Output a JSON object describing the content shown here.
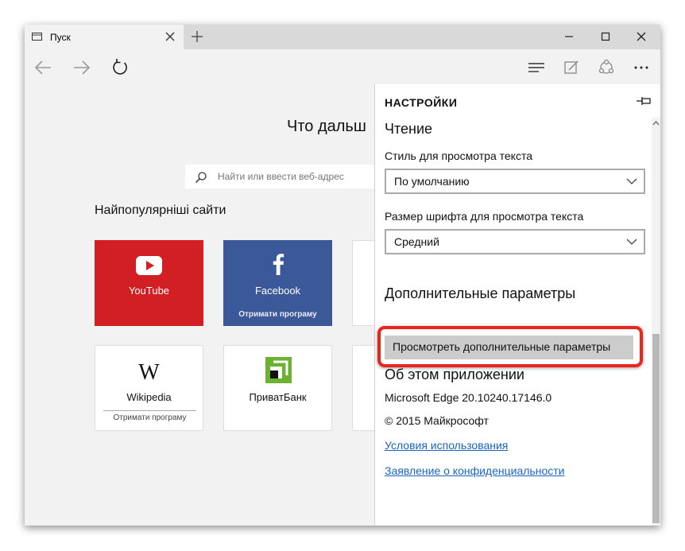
{
  "window": {
    "tab_title": "Пуск"
  },
  "start_page": {
    "heading": "Что дальш",
    "search_placeholder": "Найти или ввести веб-адрес",
    "top_sites_title": "Найпопулярніші сайти",
    "tiles": [
      {
        "label": "YouTube",
        "sub": ""
      },
      {
        "label": "Facebook",
        "sub": "Отримати програму"
      },
      {
        "label": "Wikipedia",
        "sub": "Отримати програму"
      },
      {
        "label": "ПриватБанк",
        "sub": ""
      }
    ],
    "wikipedia_logo_text": "W"
  },
  "settings": {
    "title": "НАСТРОЙКИ",
    "reading_heading": "Чтение",
    "reading_style_label": "Стиль для просмотра текста",
    "reading_style_value": "По умолчанию",
    "font_size_label": "Размер шрифта для просмотра текста",
    "font_size_value": "Средний",
    "advanced_heading": "Дополнительные параметры",
    "advanced_button": "Просмотреть дополнительные параметры",
    "about_heading": "Об этом приложении",
    "version": "Microsoft Edge 20.10240.17146.0",
    "copyright": "© 2015 Майкрософт",
    "terms_link": "Условия использования",
    "privacy_link": "Заявление о конфиденциальности"
  },
  "colors": {
    "youtube_tile": "#d21f24",
    "facebook_tile": "#3b5998",
    "link": "#1a64c4",
    "highlight": "#e8261e",
    "privatbank_green": "#6bb32e"
  }
}
